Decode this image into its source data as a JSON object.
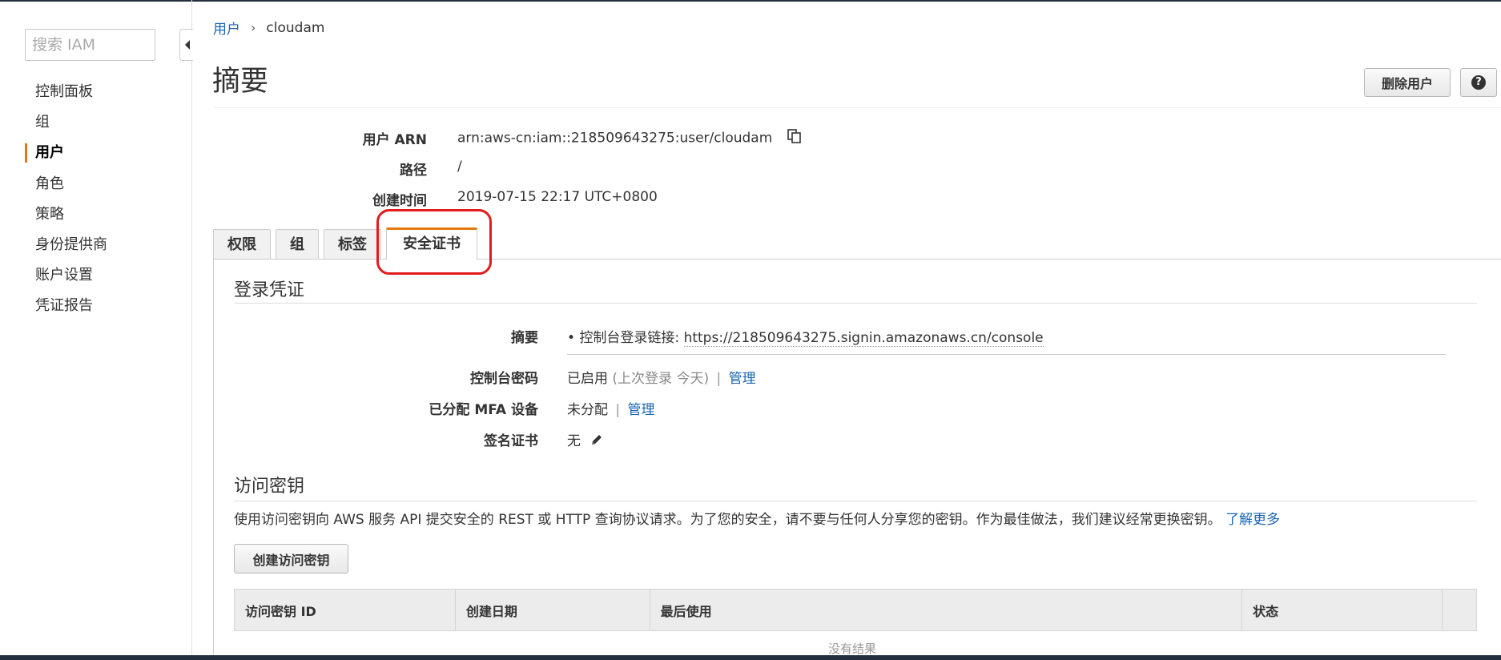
{
  "sidebar": {
    "search_placeholder": "搜索 IAM",
    "items": [
      {
        "label": "控制面板",
        "active": false
      },
      {
        "label": "组",
        "active": false
      },
      {
        "label": "用户",
        "active": true
      },
      {
        "label": "角色",
        "active": false
      },
      {
        "label": "策略",
        "active": false
      },
      {
        "label": "身份提供商",
        "active": false
      },
      {
        "label": "账户设置",
        "active": false
      },
      {
        "label": "凭证报告",
        "active": false
      }
    ]
  },
  "breadcrumb": {
    "parent": "用户",
    "separator": "›",
    "current": "cloudam"
  },
  "header": {
    "title": "摘要",
    "delete_button": "删除用户",
    "help_icon": "?"
  },
  "summary": {
    "arn_label": "用户 ARN",
    "arn_value": "arn:aws-cn:iam::218509643275:user/cloudam",
    "path_label": "路径",
    "path_value": "/",
    "created_label": "创建时间",
    "created_value": "2019-07-15 22:17 UTC+0800"
  },
  "tabs": [
    {
      "label": "权限",
      "active": false
    },
    {
      "label": "组",
      "active": false
    },
    {
      "label": "标签",
      "active": false
    },
    {
      "label": "安全证书",
      "active": true
    }
  ],
  "login_credentials": {
    "title": "登录凭证",
    "summary_label": "摘要",
    "summary_prefix": "控制台登录链接:",
    "summary_url": "https://218509643275.signin.amazonaws.cn/console",
    "console_password_label": "控制台密码",
    "console_password_status": "已启用",
    "console_password_note": "(上次登录 今天)",
    "console_password_manage": "管理",
    "mfa_label": "已分配 MFA 设备",
    "mfa_status": "未分配",
    "mfa_manage": "管理",
    "signing_cert_label": "签名证书",
    "signing_cert_value": "无",
    "separator": "|"
  },
  "access_keys": {
    "title": "访问密钥",
    "description": "使用访问密钥向 AWS 服务 API 提交安全的 REST 或 HTTP 查询协议请求。为了您的安全，请不要与任何人分享您的密钥。作为最佳做法，我们建议经常更换密钥。",
    "learn_more": "了解更多",
    "create_button": "创建访问密钥",
    "columns": [
      "访问密钥 ID",
      "创建日期",
      "最后使用",
      "状态",
      ""
    ],
    "no_results": "没有结果"
  },
  "colors": {
    "accent": "#e47911",
    "link": "#1a66b5",
    "annotation": "#e21b1b",
    "nav_bar": "#232f3e"
  }
}
